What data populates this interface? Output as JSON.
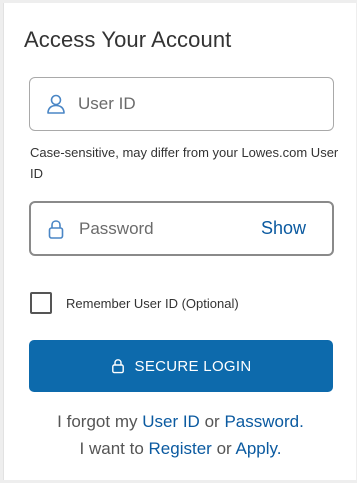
{
  "form": {
    "title": "Access Your Account",
    "userid_placeholder": "User ID",
    "userid_value": "",
    "userid_hint": "Case-sensitive, may differ from your Lowes.com User ID",
    "password_placeholder": "Password",
    "password_value": "",
    "show_label": "Show",
    "remember_label": "Remember User ID (Optional)",
    "remember_checked": false,
    "login_label": "SECURE LOGIN"
  },
  "links": {
    "forgot_prefix": "I forgot my",
    "forgot_userid": "User ID",
    "forgot_or": "or",
    "forgot_password": "Password.",
    "want_prefix": "I want to",
    "register": "Register",
    "want_or": "or",
    "apply": "Apply."
  },
  "colors": {
    "brand_blue": "#0d6aac",
    "link_blue": "#0b5aa0",
    "icon_blue": "#4a86c5"
  },
  "icons": {
    "user_field": "user-icon",
    "password_field": "lock-icon",
    "login_button": "lock-icon"
  }
}
